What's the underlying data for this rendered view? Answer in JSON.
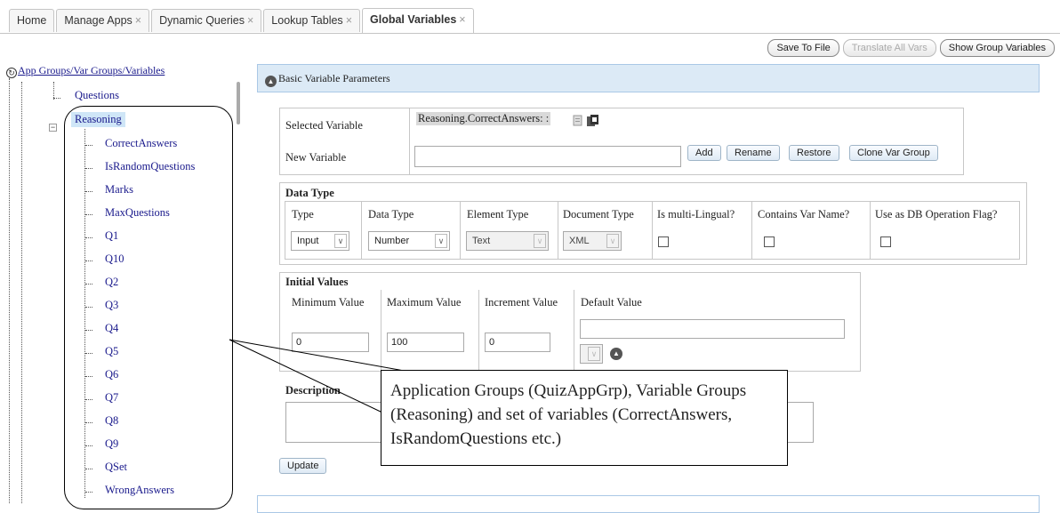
{
  "tabs": [
    {
      "label": "Home",
      "closable": false
    },
    {
      "label": "Manage Apps",
      "closable": true
    },
    {
      "label": "Dynamic Queries",
      "closable": true
    },
    {
      "label": "Lookup Tables",
      "closable": true
    },
    {
      "label": "Global Variables",
      "closable": true
    }
  ],
  "tab_close_glyph": "×",
  "toolbar": {
    "save": "Save To File",
    "translate": "Translate All Vars",
    "show_groups": "Show Group Variables"
  },
  "tree": {
    "root": "App Groups/Var Groups/Variables",
    "questions": "Questions",
    "reasoning": "Reasoning",
    "items": [
      "CorrectAnswers",
      "IsRandomQuestions",
      "Marks",
      "MaxQuestions",
      "Q1",
      "Q10",
      "Q2",
      "Q3",
      "Q4",
      "Q5",
      "Q6",
      "Q7",
      "Q8",
      "Q9",
      "QSet",
      "WrongAnswers"
    ]
  },
  "panel": {
    "title": "Basic Variable Parameters",
    "selected_label": "Selected Variable",
    "selected_value": "Reasoning.CorrectAnswers: :",
    "new_label": "New Variable",
    "new_value": "",
    "buttons": {
      "add": "Add",
      "rename": "Rename",
      "restore": "Restore",
      "clone": "Clone Var Group"
    }
  },
  "data_type": {
    "heading": "Data Type",
    "headers": [
      "Type",
      "Data Type",
      "Element Type",
      "Document Type",
      "Is multi-Lingual?",
      "Contains Var Name?",
      "Use as DB Operation Flag?"
    ],
    "type": "Input",
    "data_type": "Number",
    "element_type": "Text",
    "document_type": "XML",
    "multi_lingual": false,
    "contains_var_name": false,
    "db_flag": false
  },
  "initial_values": {
    "heading": "Initial Values",
    "headers": [
      "Minimum Value",
      "Maximum Value",
      "Increment Value",
      "Default Value"
    ],
    "min": "0",
    "max": "100",
    "increment": "0",
    "default": ""
  },
  "description": {
    "label": "Description",
    "value": ""
  },
  "update_button": "Update",
  "callout": "Application Groups (QuizAppGrp), Variable Groups (Reasoning) and set of variables (CorrectAnswers, IsRandomQuestions etc.)",
  "icons": {
    "root": "refresh-circle-icon",
    "collapse": "circle-chevron-up-icon",
    "copy": "copy-icon",
    "doc": "document-icon"
  }
}
